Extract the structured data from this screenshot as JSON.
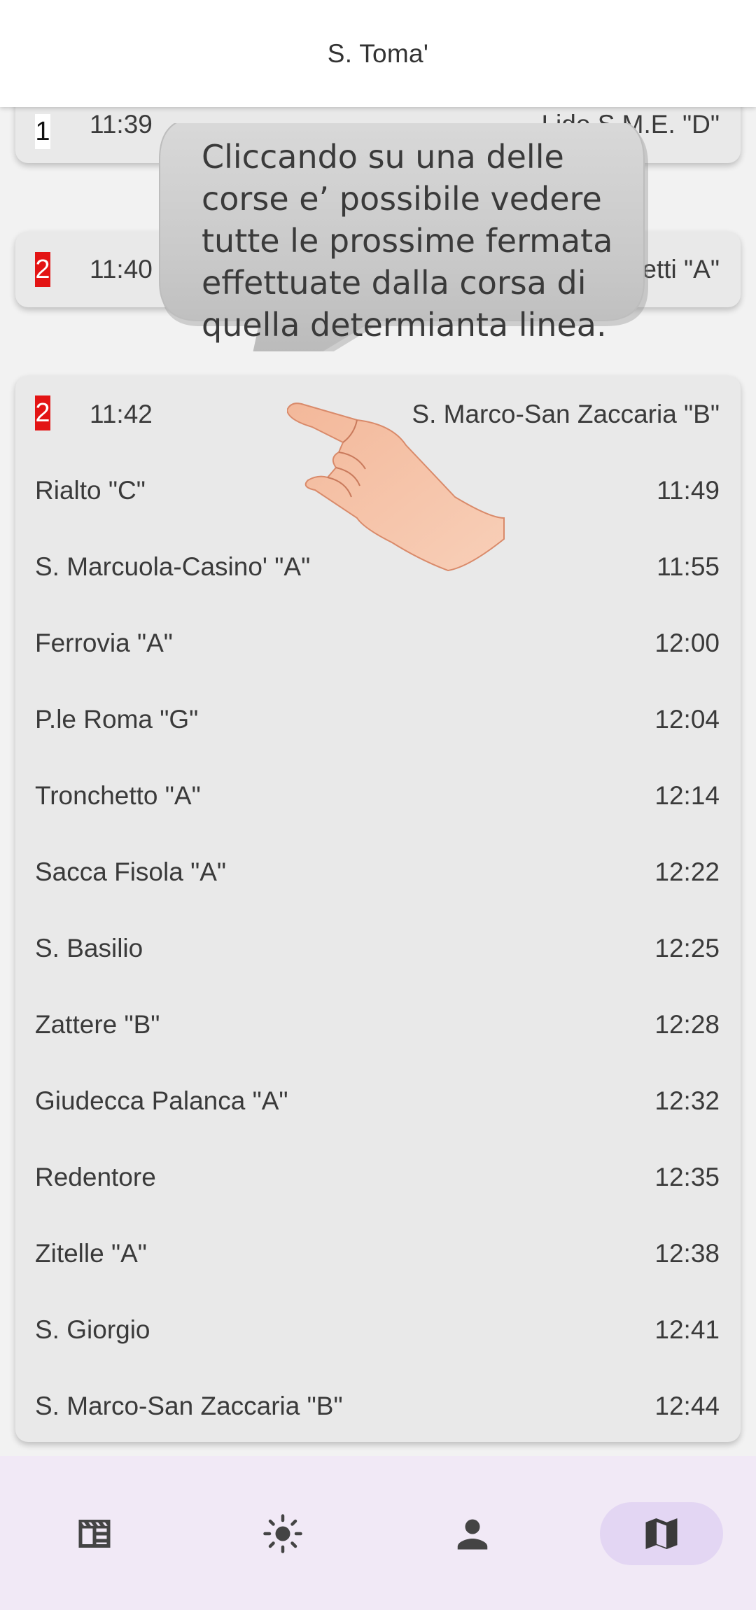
{
  "header": {
    "title": "S. Toma'"
  },
  "departures": [
    {
      "line": "1",
      "line_color": "#ffffff",
      "time": "11:39",
      "destination": "Lido S.M.E. \"D\""
    },
    {
      "line": "2",
      "line_color": "#e31414",
      "time": "11:40",
      "destination": "etti \"A\""
    },
    {
      "line": "2",
      "line_color": "#e31414",
      "time": "11:42",
      "destination": "S. Marco-San Zaccaria \"B\""
    }
  ],
  "stops": [
    {
      "name": "Rialto \"C\"",
      "time": "11:49"
    },
    {
      "name": "S. Marcuola-Casino' \"A\"",
      "time": "11:55"
    },
    {
      "name": "Ferrovia \"A\"",
      "time": "12:00"
    },
    {
      "name": "P.le Roma \"G\"",
      "time": "12:04"
    },
    {
      "name": "Tronchetto \"A\"",
      "time": "12:14"
    },
    {
      "name": "Sacca Fisola \"A\"",
      "time": "12:22"
    },
    {
      "name": "S. Basilio",
      "time": "12:25"
    },
    {
      "name": "Zattere \"B\"",
      "time": "12:28"
    },
    {
      "name": "Giudecca Palanca \"A\"",
      "time": "12:32"
    },
    {
      "name": "Redentore",
      "time": "12:35"
    },
    {
      "name": "Zitelle \"A\"",
      "time": "12:38"
    },
    {
      "name": "S. Giorgio",
      "time": "12:41"
    },
    {
      "name": "S. Marco-San Zaccaria \"B\"",
      "time": "12:44"
    }
  ],
  "tooltip": {
    "text": "Cliccando su una delle corse e’ possibile vedere tutte le prossime fermata effettuate dalla corsa di quella determianta linea."
  },
  "bottom_nav": [
    {
      "icon": "timetable-icon",
      "active": false
    },
    {
      "icon": "sun-icon",
      "active": false
    },
    {
      "icon": "person-icon",
      "active": false
    },
    {
      "icon": "map-icon",
      "active": true
    }
  ],
  "colors": {
    "card_bg": "#e9e9e9",
    "line_red": "#e31414",
    "nav_bg": "#f1e9f6",
    "nav_active": "#e3d6f3"
  }
}
